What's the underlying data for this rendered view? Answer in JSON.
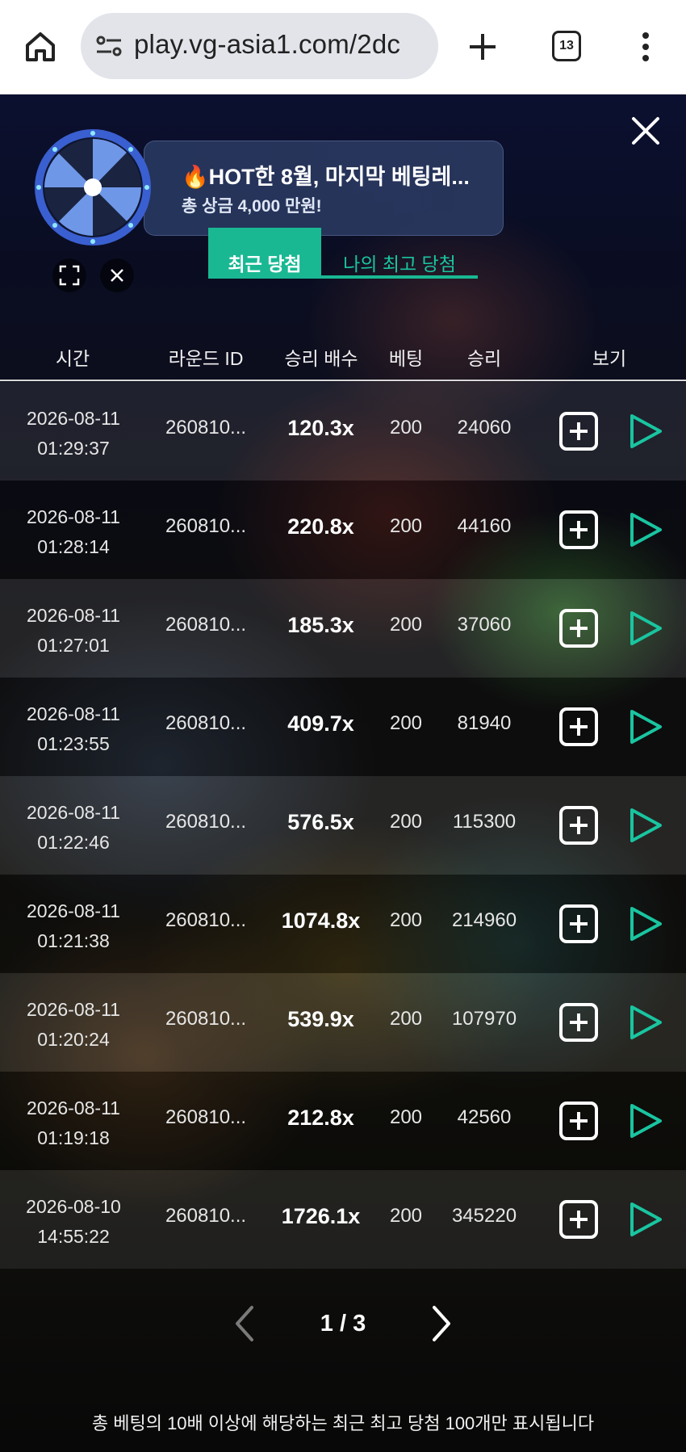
{
  "browser": {
    "url": "play.vg-asia1.com/2dc",
    "tab_count": "13"
  },
  "promo": {
    "title": "🔥HOT한 8월, 마지막 베팅레...",
    "subtitle": "총 상금 4,000 만원!"
  },
  "tabs": {
    "recent": "최근 당첨",
    "best": "나의 최고 당첨"
  },
  "table": {
    "headers": {
      "time": "시간",
      "round": "라운드 ID",
      "multiplier": "승리 배수",
      "bet": "베팅",
      "win": "승리",
      "view": "보기"
    },
    "rows": [
      {
        "date": "2026-08-11",
        "time": "01:29:37",
        "round": "260810...",
        "multiplier": "120.3x",
        "bet": "200",
        "win": "24060"
      },
      {
        "date": "2026-08-11",
        "time": "01:28:14",
        "round": "260810...",
        "multiplier": "220.8x",
        "bet": "200",
        "win": "44160"
      },
      {
        "date": "2026-08-11",
        "time": "01:27:01",
        "round": "260810...",
        "multiplier": "185.3x",
        "bet": "200",
        "win": "37060"
      },
      {
        "date": "2026-08-11",
        "time": "01:23:55",
        "round": "260810...",
        "multiplier": "409.7x",
        "bet": "200",
        "win": "81940"
      },
      {
        "date": "2026-08-11",
        "time": "01:22:46",
        "round": "260810...",
        "multiplier": "576.5x",
        "bet": "200",
        "win": "115300"
      },
      {
        "date": "2026-08-11",
        "time": "01:21:38",
        "round": "260810...",
        "multiplier": "1074.8x",
        "bet": "200",
        "win": "214960"
      },
      {
        "date": "2026-08-11",
        "time": "01:20:24",
        "round": "260810...",
        "multiplier": "539.9x",
        "bet": "200",
        "win": "107970"
      },
      {
        "date": "2026-08-11",
        "time": "01:19:18",
        "round": "260810...",
        "multiplier": "212.8x",
        "bet": "200",
        "win": "42560"
      },
      {
        "date": "2026-08-10",
        "time": "14:55:22",
        "round": "260810...",
        "multiplier": "1726.1x",
        "bet": "200",
        "win": "345220"
      }
    ]
  },
  "pagination": {
    "label": "1 / 3"
  },
  "footer": {
    "note": "총 베팅의 10배 이상에 해당하는 최근 최고 당첨 100개만 표시됩니다"
  },
  "colors": {
    "accent": "#19b893",
    "play_icon": "#19c5a0"
  }
}
